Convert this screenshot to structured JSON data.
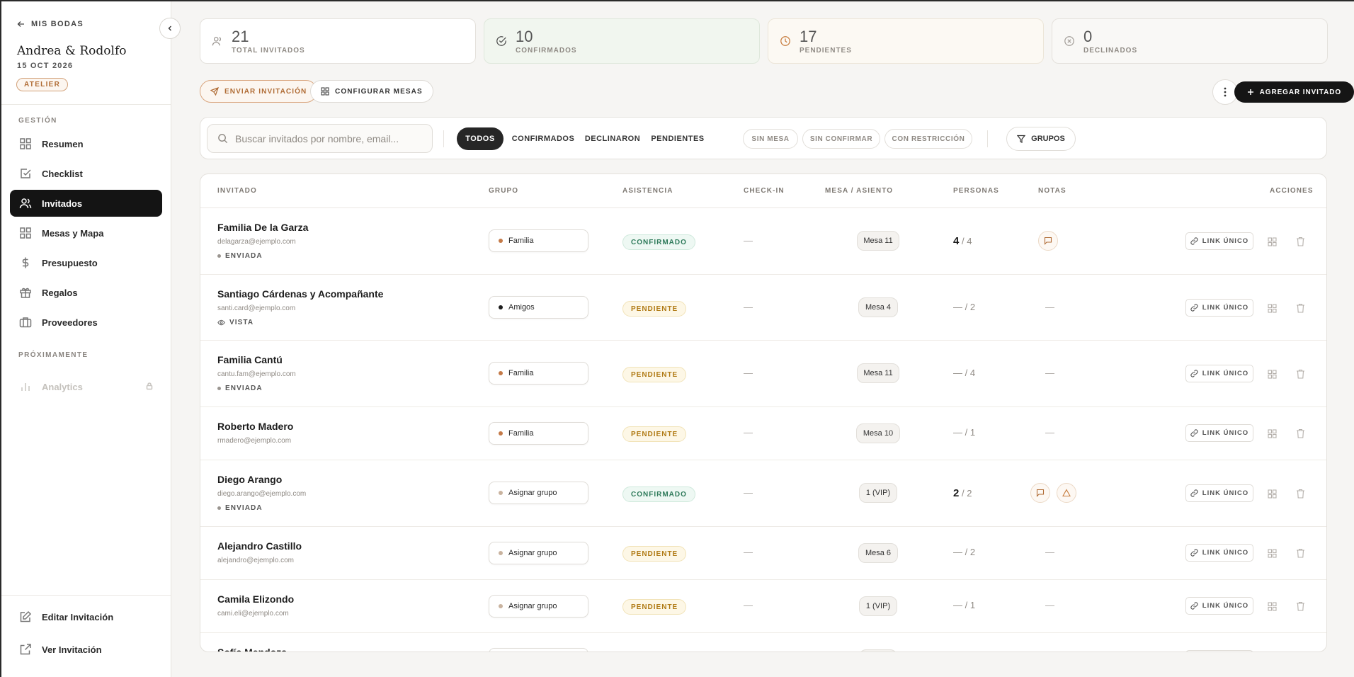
{
  "sidebar": {
    "back_label": "MIS BODAS",
    "couple": "Andrea & Rodolfo",
    "date": "15 OCT 2026",
    "plan": "ATELIER",
    "section_gestion": "GESTIÓN",
    "section_proximamente": "PRÓXIMAMENTE",
    "nav": [
      {
        "label": "Resumen",
        "icon": "grid-icon"
      },
      {
        "label": "Checklist",
        "icon": "checkbox-icon"
      },
      {
        "label": "Invitados",
        "icon": "users-icon"
      },
      {
        "label": "Mesas y Mapa",
        "icon": "grid-icon"
      },
      {
        "label": "Presupuesto",
        "icon": "dollar-icon"
      },
      {
        "label": "Regalos",
        "icon": "gift-icon"
      },
      {
        "label": "Proveedores",
        "icon": "briefcase-icon"
      }
    ],
    "analytics": "Analytics",
    "edit_invitation": "Editar Invitación",
    "view_invitation": "Ver Invitación"
  },
  "stats": [
    {
      "value": "21",
      "label": "TOTAL INVITADOS"
    },
    {
      "value": "10",
      "label": "CONFIRMADOS"
    },
    {
      "value": "17",
      "label": "PENDIENTES"
    },
    {
      "value": "0",
      "label": "DECLINADOS"
    }
  ],
  "actions": {
    "send_invitation": "ENVIAR INVITACIÓN",
    "configure_tables": "CONFIGURAR MESAS",
    "add_guest": "AGREGAR INVITADO"
  },
  "filters": {
    "search_placeholder": "Buscar invitados por nombre, email...",
    "tabs": [
      "TODOS",
      "CONFIRMADOS",
      "DECLINARON",
      "PENDIENTES"
    ],
    "chips": [
      "SIN MESA",
      "SIN CONFIRMAR",
      "CON RESTRICCIÓN"
    ],
    "groups": "GRUPOS"
  },
  "table": {
    "headers": [
      "INVITADO",
      "GRUPO",
      "ASISTENCIA",
      "CHECK-IN",
      "MESA / ASIENTO",
      "PERSONAS",
      "NOTAS",
      "ACCIONES"
    ],
    "link_label": "LINK ÚNICO",
    "dash": "—",
    "rows": [
      {
        "name": "Familia De la Garza",
        "email": "delagarza@ejemplo.com",
        "invite_status": "ENVIADA",
        "group": "Familia",
        "attendance": "CONFIRMADO",
        "checkin": "—",
        "table": "Mesa 11",
        "persons_conf": "4",
        "persons_total": "/ 4",
        "notes": "—"
      },
      {
        "name": "Santiago Cárdenas y Acompañante",
        "email": "santi.card@ejemplo.com",
        "invite_status": "VISTA",
        "group": "Amigos",
        "attendance": "PENDIENTE",
        "checkin": "—",
        "table": "Mesa 4",
        "persons_conf": "—",
        "persons_total": "/ 2",
        "notes": "—"
      },
      {
        "name": "Familia Cantú",
        "email": "cantu.fam@ejemplo.com",
        "invite_status": "ENVIADA",
        "group": "Familia",
        "attendance": "PENDIENTE",
        "checkin": "—",
        "table": "Mesa 11",
        "persons_conf": "—",
        "persons_total": "/ 4",
        "notes": "—"
      },
      {
        "name": "Roberto Madero",
        "email": "rmadero@ejemplo.com",
        "invite_status": "",
        "group": "Familia",
        "attendance": "PENDIENTE",
        "checkin": "—",
        "table": "Mesa 10",
        "persons_conf": "—",
        "persons_total": "/ 1",
        "notes": "—"
      },
      {
        "name": "Diego Arango",
        "email": "diego.arango@ejemplo.com",
        "invite_status": "ENVIADA",
        "group": "Asignar grupo",
        "attendance": "CONFIRMADO",
        "checkin": "—",
        "table": "1 (VIP)",
        "persons_conf": "2",
        "persons_total": "/ 2",
        "notes": "—"
      },
      {
        "name": "Alejandro Castillo",
        "email": "alejandro@ejemplo.com",
        "invite_status": "",
        "group": "Asignar grupo",
        "attendance": "PENDIENTE",
        "checkin": "—",
        "table": "Mesa 6",
        "persons_conf": "—",
        "persons_total": "/ 2",
        "notes": "—"
      },
      {
        "name": "Camila Elizondo",
        "email": "cami.eli@ejemplo.com",
        "invite_status": "",
        "group": "Asignar grupo",
        "attendance": "PENDIENTE",
        "checkin": "—",
        "table": "1 (VIP)",
        "persons_conf": "—",
        "persons_total": "/ 1",
        "notes": "—"
      },
      {
        "name": "Sofía Mendoza"
      }
    ]
  },
  "colors": {
    "accent": "#b06c35",
    "dark": "#141414",
    "confirmed": "#2e7a5a",
    "pending": "#b07a14",
    "family_dot": "#c47a48",
    "friends_dot": "#1c1c1c",
    "unassigned_dot": "#c9b39f"
  }
}
